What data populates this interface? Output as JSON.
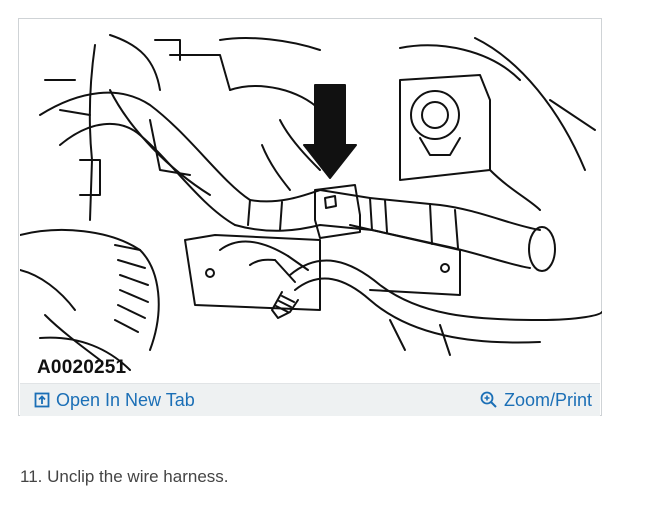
{
  "figure": {
    "id_label": "A0020251",
    "open_tab_label": "Open In New Tab",
    "zoom_label": "Zoom/Print",
    "open_tab_icon": "open-new-tab-icon",
    "zoom_icon": "magnifier-plus-icon",
    "link_color": "#1b6fb6",
    "toolbar_bg": "#eef1f2"
  },
  "step": {
    "text": "11. Unclip the wire harness."
  }
}
